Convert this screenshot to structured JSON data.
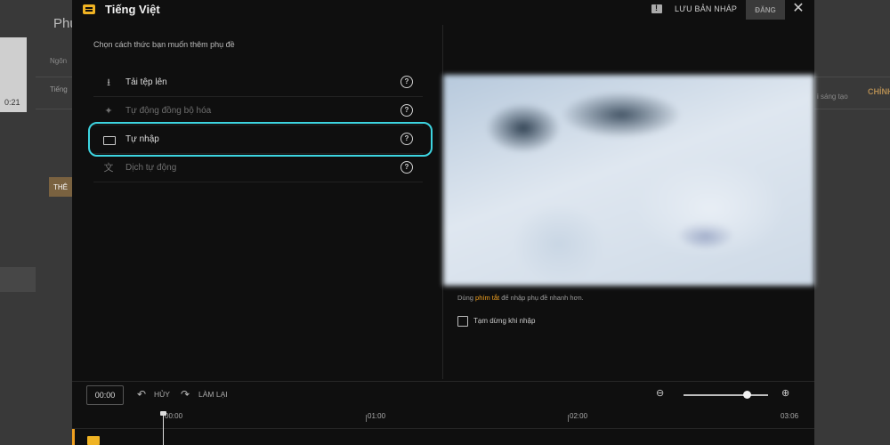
{
  "background": {
    "title": "Phụ",
    "thumb_time": "0:21",
    "language_label": "Ngôn",
    "language_value": "Tiếng",
    "button": "THÊ",
    "creator_text": "i sáng tạo",
    "right_link": "CHỈNH"
  },
  "dialog": {
    "title": "Tiếng Việt",
    "save_draft": "LƯU BẢN NHÁP",
    "publish": "ĐĂNG",
    "instruction": "Chọn cách thức bạn muốn thêm phụ đề",
    "options": [
      {
        "label": "Tải tệp lên",
        "icon": "upload-icon",
        "enabled": true
      },
      {
        "label": "Tự động đồng bộ hóa",
        "icon": "auto-sync-icon",
        "enabled": false
      },
      {
        "label": "Tự nhập",
        "icon": "keyboard-icon",
        "enabled": true,
        "highlighted": true
      },
      {
        "label": "Dịch tự động",
        "icon": "translate-icon",
        "enabled": false
      }
    ],
    "hint_before": "Dùng",
    "hint_link": "phím tắt",
    "hint_after": "để nhập phụ đề nhanh hơn.",
    "pause_label": "Tạm dừng khi nhập",
    "pause_checked": false
  },
  "toolbar": {
    "time": "00:00",
    "undo": "HỦY",
    "redo": "LÀM LẠI",
    "zoom_level": 0.75
  },
  "timeline": {
    "ticks": [
      "00:00",
      "01:00",
      "02:00",
      "03:06"
    ]
  },
  "colors": {
    "accent": "#f0b323",
    "highlight": "#3dd4e0",
    "link": "#f0a020"
  }
}
